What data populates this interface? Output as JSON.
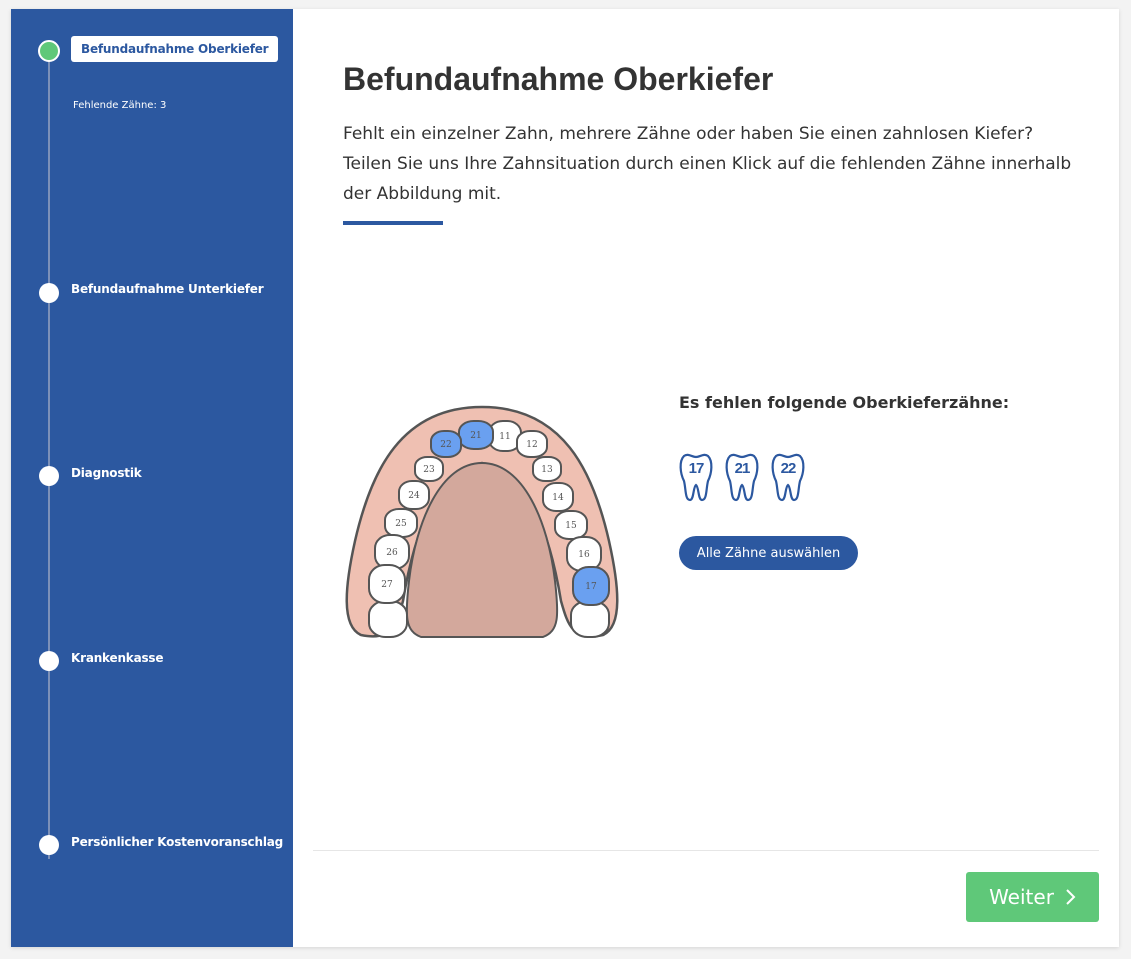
{
  "sidebar": {
    "steps": [
      {
        "label": "Befundaufnahme Oberkiefer",
        "sub": "Fehlende Zähne: 3"
      },
      {
        "label": "Befundaufnahme Unterkiefer"
      },
      {
        "label": "Diagnostik"
      },
      {
        "label": "Krankenkasse"
      },
      {
        "label": "Persönlicher Kostenvoranschlag"
      }
    ]
  },
  "main": {
    "title": "Befundaufnahme Oberkiefer",
    "intro": "Fehlt ein einzelner Zahn, mehrere Zähne oder haben Sie einen zahnlosen Kiefer? Teilen Sie uns Ihre Zahnsituation durch einen Klick auf die fehlenden Zähne innerhalb der Abbildung mit.",
    "jaw": {
      "teeth": [
        "11",
        "12",
        "13",
        "14",
        "15",
        "16",
        "17",
        "21",
        "22",
        "23",
        "24",
        "25",
        "26",
        "27"
      ],
      "selected": [
        "17",
        "21",
        "22"
      ]
    },
    "missing_title": "Es fehlen folgende Oberkieferzähne:",
    "missing_teeth": [
      "17",
      "21",
      "22"
    ],
    "select_all_label": "Alle Zähne auswählen"
  },
  "footer": {
    "next_label": "Weiter"
  },
  "colors": {
    "primary": "#2c58a0",
    "success": "#5fc879",
    "selected_tooth": "#6aa0f0",
    "gum": "#efc0b2",
    "palate": "#d3a89c"
  }
}
